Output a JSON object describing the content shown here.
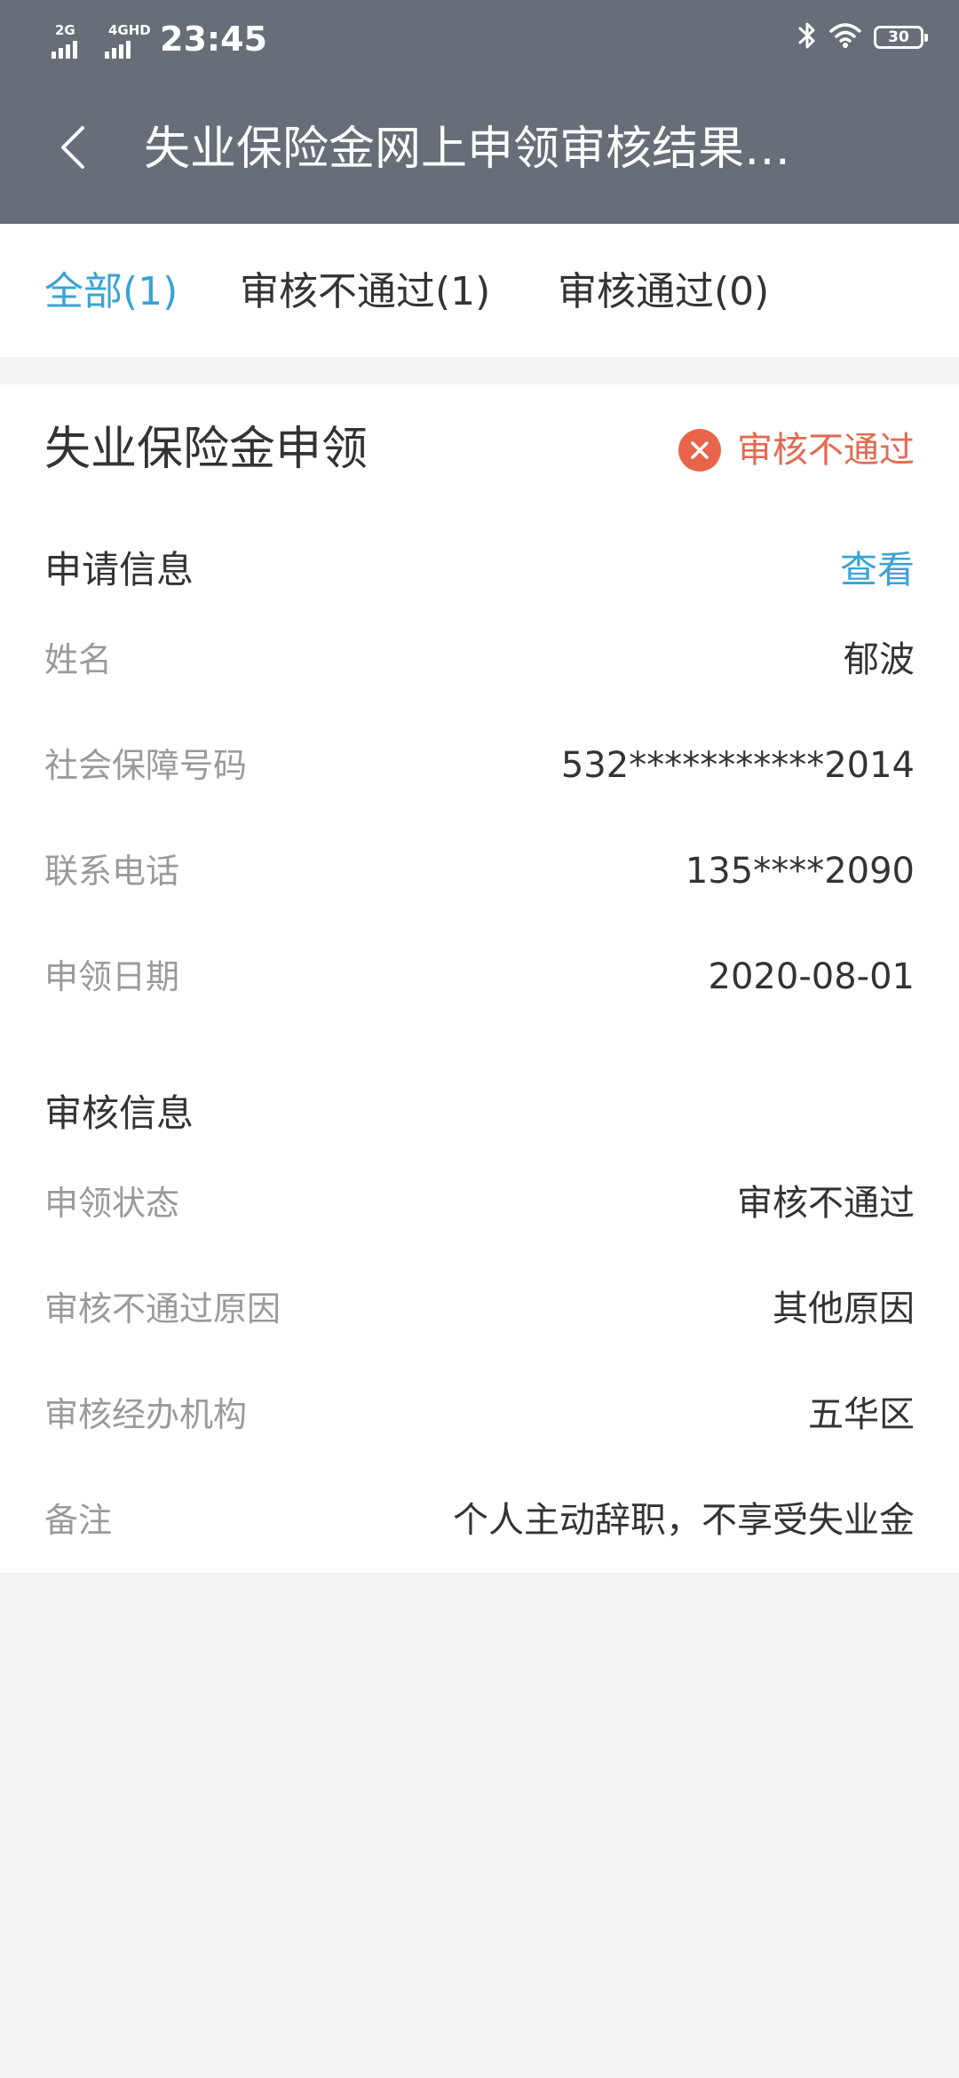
{
  "status_bar": {
    "network_1": "2G",
    "network_2": "4GHD",
    "time": "23:45",
    "battery": "30"
  },
  "nav": {
    "title": "失业保险金网上申领审核结果…"
  },
  "tabs": [
    {
      "label": "全部(1)",
      "active": true
    },
    {
      "label": "审核不通过(1)",
      "active": false
    },
    {
      "label": "审核通过(0)",
      "active": false
    }
  ],
  "record": {
    "title": "失业保险金申领",
    "status": "审核不通过",
    "status_color": "#e8654c",
    "application_section": {
      "title": "申请信息",
      "view_label": "查看",
      "rows": [
        {
          "label": "姓名",
          "value": "郁波"
        },
        {
          "label": "社会保障号码",
          "value": "532***********2014"
        },
        {
          "label": "联系电话",
          "value": "135****2090"
        },
        {
          "label": "申领日期",
          "value": "2020-08-01"
        }
      ]
    },
    "review_section": {
      "title": "审核信息",
      "rows": [
        {
          "label": "申领状态",
          "value": "审核不通过"
        },
        {
          "label": "审核不通过原因",
          "value": "其他原因"
        },
        {
          "label": "审核经办机构",
          "value": "五华区"
        },
        {
          "label": "备注",
          "value": "个人主动辞职，不享受失业金"
        }
      ]
    }
  },
  "colors": {
    "header_bg": "#676e78",
    "accent_blue": "#3aa3d3",
    "reject_red": "#e8654c",
    "page_bg": "#f3f3f3"
  }
}
